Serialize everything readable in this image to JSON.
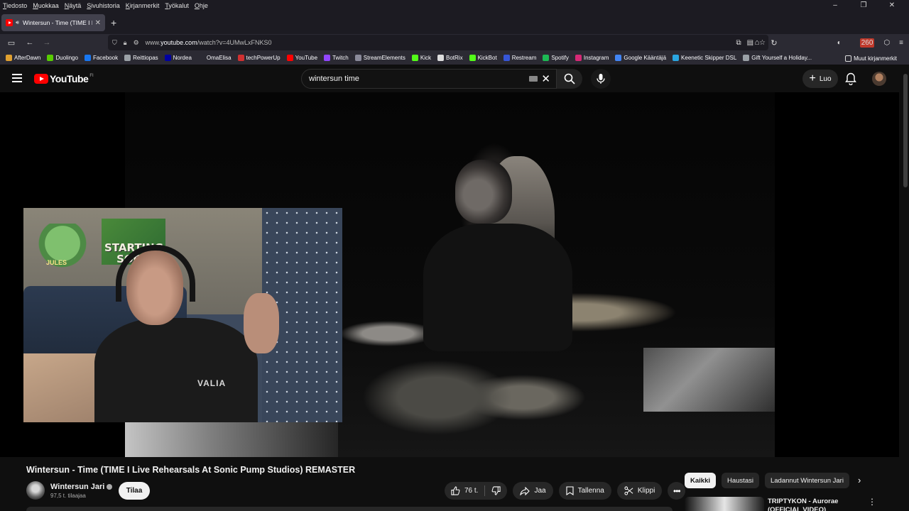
{
  "menu": [
    "Tiedosto",
    "Muokkaa",
    "Näytä",
    "Sivuhistoria",
    "Kirjanmerkit",
    "Työkalut",
    "Ohje"
  ],
  "window_controls": {
    "minimize": "–",
    "restore": "❐",
    "close": "✕"
  },
  "tab": {
    "title": "Wintersun - Time (TIME I Live",
    "close": "✕"
  },
  "newtab": "+",
  "address": {
    "prefix": "www.",
    "domain": "youtube.com",
    "path": "/watch?v=4UMwLxFNKS0"
  },
  "badge_count": "260",
  "bookmarks": [
    {
      "label": "AfterDawn",
      "color": "#e0a030"
    },
    {
      "label": "Duolingo",
      "color": "#58cc02"
    },
    {
      "label": "Facebook",
      "color": "#1877f2"
    },
    {
      "label": "Reittiopas",
      "color": "#9aa0a6"
    },
    {
      "label": "Nordea",
      "color": "#0000a0"
    },
    {
      "label": "OmaElisa",
      "color": "#2b2a33"
    },
    {
      "label": "techPowerUp",
      "color": "#d03030"
    },
    {
      "label": "YouTube",
      "color": "#ff0000"
    },
    {
      "label": "Twitch",
      "color": "#9146ff"
    },
    {
      "label": "StreamElements",
      "color": "#8a8a9a"
    },
    {
      "label": "Kick",
      "color": "#53fc18"
    },
    {
      "label": "BotRix",
      "color": "#dddddd"
    },
    {
      "label": "KickBot",
      "color": "#53fc18"
    },
    {
      "label": "Restream",
      "color": "#3656d8"
    },
    {
      "label": "Spotify",
      "color": "#1db954"
    },
    {
      "label": "Instagram",
      "color": "#d62976"
    },
    {
      "label": "Google Kääntäjä",
      "color": "#4285f4"
    },
    {
      "label": "Keenetic Skipper DSL",
      "color": "#2aa6e0"
    },
    {
      "label": "Gift Yourself a Holiday...",
      "color": "#9aa0a6"
    }
  ],
  "bookmarks_other": "Muut kirjanmerkit",
  "youtube": {
    "logo_text": "YouTube",
    "country": "FI",
    "search_value": "wintersun time",
    "create_label": "Luo"
  },
  "webcam": {
    "poster_text": "STARTING SOON",
    "turtle_name": "JULES",
    "shirt_text": "VALIA"
  },
  "video": {
    "title": "Wintersun - Time (TIME I Live Rehearsals At Sonic Pump Studios) REMASTER",
    "channel": "Wintersun Jari",
    "subscribers": "97,5 t. tilaajaa",
    "subscribe_label": "Tilaa",
    "likes": "76 t.",
    "share_label": "Jaa",
    "save_label": "Tallenna",
    "clip_label": "Klippi"
  },
  "chips": [
    "Kaikki",
    "Haustasi",
    "Ladannut Wintersun Jari"
  ],
  "recommendation": {
    "title": "TRIPTYKON - Aurorae (OFFICIAL VIDEO)"
  }
}
